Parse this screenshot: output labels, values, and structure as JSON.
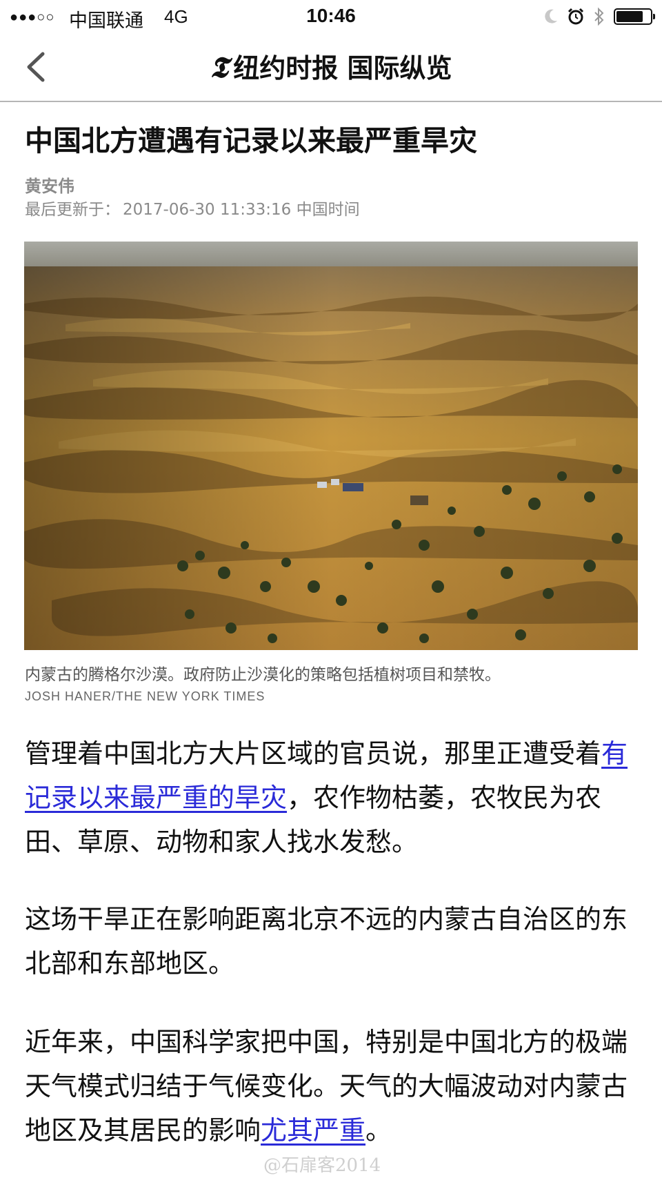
{
  "status_bar": {
    "signal": "●●●○○",
    "carrier": "中国联通",
    "network": "4G",
    "time": "10:46",
    "icons": [
      "moon-icon",
      "alarm-icon",
      "bluetooth-icon",
      "battery-icon"
    ],
    "battery_level": 0.8
  },
  "nav": {
    "back_icon": "chevron-left-icon",
    "brand_logo": "𝕿",
    "title": "纽约时报  国际纵览"
  },
  "article": {
    "headline": "中国北方遭遇有记录以来最严重旱灾",
    "author": "黄安伟",
    "updated_label": "最后更新于：",
    "updated_time": "2017-06-30 11:33:16 中国时间",
    "photo_caption": "内蒙古的腾格尔沙漠。政府防止沙漠化的策略包括植树项目和禁牧。",
    "photo_credit": "JOSH HANER/THE NEW YORK TIMES",
    "p1_a": "管理着中国北方大片区域的官员说，那里正遭受着",
    "p1_link": "有记录以来最严重的旱灾",
    "p1_b": "，农作物枯萎，农牧民为农田、草原、动物和家人找水发愁。",
    "p2": "这场干旱正在影响距离北京不远的内蒙古自治区的东北部和东部地区。",
    "p3_a": "近年来，中国科学家把中国，特别是中国北方的极端天气模式归结于气候变化。天气的大幅波动对内蒙古地区及其居民的影响",
    "p3_link": "尤其严重",
    "p3_b": "。"
  },
  "watermark": "@石扉客2014",
  "colors": {
    "link": "#2a2ad8",
    "meta_gray": "#8a8a8a",
    "sand": "#c9993f",
    "divider": "#b5b5b5"
  }
}
